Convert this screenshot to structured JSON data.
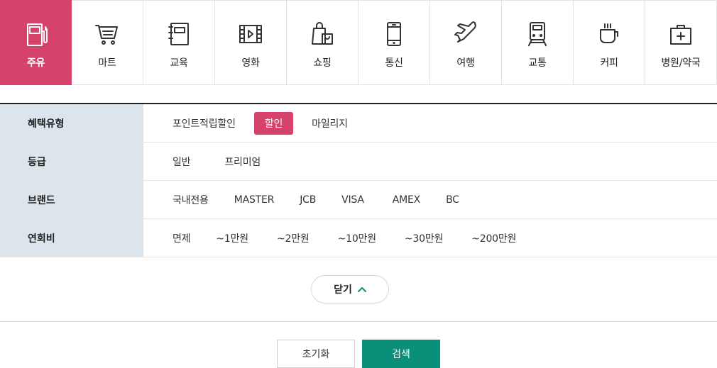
{
  "categories": [
    {
      "label": "주유",
      "icon": "gas-station-icon",
      "active": true
    },
    {
      "label": "마트",
      "icon": "shopping-cart-icon",
      "active": false
    },
    {
      "label": "교육",
      "icon": "notebook-icon",
      "active": false
    },
    {
      "label": "영화",
      "icon": "film-icon",
      "active": false
    },
    {
      "label": "쇼핑",
      "icon": "shopping-bag-icon",
      "active": false
    },
    {
      "label": "통신",
      "icon": "smartphone-icon",
      "active": false
    },
    {
      "label": "여행",
      "icon": "airplane-icon",
      "active": false
    },
    {
      "label": "교통",
      "icon": "train-icon",
      "active": false
    },
    {
      "label": "커피",
      "icon": "coffee-cup-icon",
      "active": false
    },
    {
      "label": "병원/약국",
      "icon": "first-aid-kit-icon",
      "active": false
    }
  ],
  "filters": {
    "benefit": {
      "label": "혜택유형",
      "options": [
        "포인트적립할인",
        "할인",
        "마일리지"
      ],
      "selected": "할인"
    },
    "grade": {
      "label": "등급",
      "options": [
        "일반",
        "프리미엄"
      ]
    },
    "brand": {
      "label": "브랜드",
      "options": [
        "국내전용",
        "MASTER",
        "JCB",
        "VISA",
        "AMEX",
        "BC"
      ]
    },
    "fee": {
      "label": "연회비",
      "options": [
        "면제",
        "~1만원",
        "~2만원",
        "~10만원",
        "~30만원",
        "~200만원"
      ]
    }
  },
  "close_label": "닫기",
  "reset_label": "초기화",
  "search_label": "검색",
  "colors": {
    "accent_pink": "#d5436a",
    "accent_green": "#0a8f7a",
    "header_bg": "#dbe5eb"
  }
}
